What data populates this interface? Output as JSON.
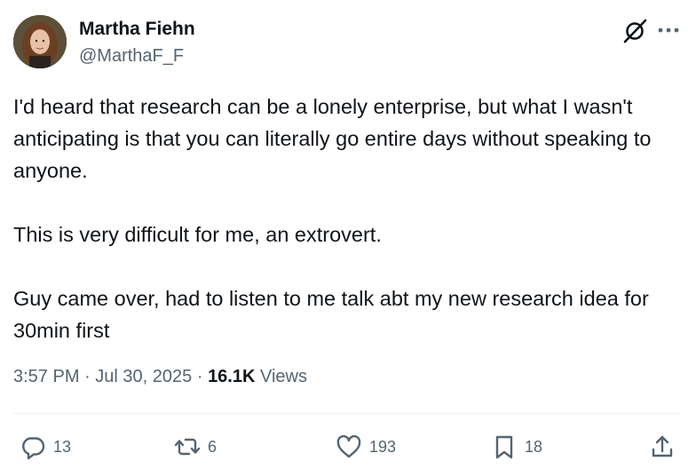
{
  "author": {
    "name": "Martha Fiehn",
    "handle": "@MarthaF_F"
  },
  "tweet": {
    "paragraphs": [
      "I'd heard that research can be a lonely enterprise, but what I wasn't anticipating is that you can literally go entire days without speaking to anyone.",
      "This is very difficult for me, an extrovert.",
      "Guy came over, had to listen to me talk abt my new research idea for 30min first"
    ]
  },
  "meta": {
    "time": "3:57 PM",
    "separator": "·",
    "date": "Jul 30, 2025",
    "views_count": "16.1K",
    "views_label": "Views"
  },
  "actions": {
    "replies": "13",
    "reposts": "6",
    "likes": "193",
    "bookmarks": "18"
  },
  "icons": {
    "header": [
      "grok-icon",
      "more-icon"
    ],
    "actions": [
      "reply-icon",
      "repost-icon",
      "like-icon",
      "bookmark-icon",
      "share-icon"
    ]
  },
  "colors": {
    "text_primary": "#0f1419",
    "text_secondary": "#536471",
    "divider": "#eff3f4",
    "background": "#ffffff"
  }
}
